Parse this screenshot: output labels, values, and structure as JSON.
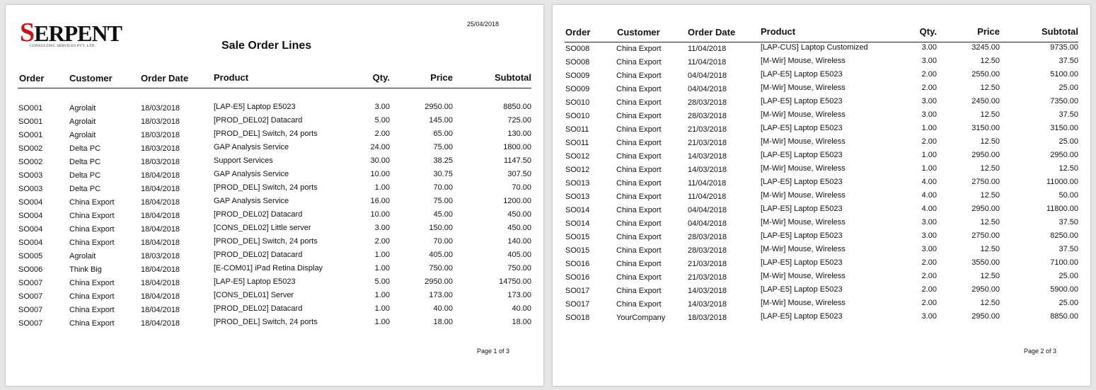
{
  "report": {
    "brand_logo_text": "SERPENT",
    "brand_logo_sub": "CONSULTING SERVICES PVT. LTD.",
    "date": "25/04/2018",
    "title": "Sale Order Lines"
  },
  "columns": {
    "order": "Order",
    "customer": "Customer",
    "order_date": "Order Date",
    "product": "Product",
    "qty": "Qty.",
    "price": "Price",
    "subtotal": "Subtotal"
  },
  "page1": {
    "footer": "Page 1 of 3",
    "rows": [
      [
        "SO001",
        "Agrolait",
        "18/03/2018",
        "[LAP-E5] Laptop E5023",
        "3.00",
        "2950.00",
        "8850.00"
      ],
      [
        "SO001",
        "Agrolait",
        "18/03/2018",
        "[PROD_DEL02] Datacard",
        "5.00",
        "145.00",
        "725.00"
      ],
      [
        "SO001",
        "Agrolait",
        "18/03/2018",
        "[PROD_DEL] Switch, 24 ports",
        "2.00",
        "65.00",
        "130.00"
      ],
      [
        "SO002",
        "Delta PC",
        "18/03/2018",
        "GAP Analysis Service",
        "24.00",
        "75.00",
        "1800.00"
      ],
      [
        "SO002",
        "Delta PC",
        "18/03/2018",
        "Support Services",
        "30.00",
        "38.25",
        "1147.50"
      ],
      [
        "SO003",
        "Delta PC",
        "18/04/2018",
        "GAP Analysis Service",
        "10.00",
        "30.75",
        "307.50"
      ],
      [
        "SO003",
        "Delta PC",
        "18/04/2018",
        "[PROD_DEL] Switch, 24 ports",
        "1.00",
        "70.00",
        "70.00"
      ],
      [
        "SO004",
        "China Export",
        "18/04/2018",
        "GAP Analysis Service",
        "16.00",
        "75.00",
        "1200.00"
      ],
      [
        "SO004",
        "China Export",
        "18/04/2018",
        "[PROD_DEL02] Datacard",
        "10.00",
        "45.00",
        "450.00"
      ],
      [
        "SO004",
        "China Export",
        "18/04/2018",
        "[CONS_DEL02] Little server",
        "3.00",
        "150.00",
        "450.00"
      ],
      [
        "SO004",
        "China Export",
        "18/04/2018",
        "[PROD_DEL] Switch, 24 ports",
        "2.00",
        "70.00",
        "140.00"
      ],
      [
        "SO005",
        "Agrolait",
        "18/03/2018",
        "[PROD_DEL02] Datacard",
        "1.00",
        "405.00",
        "405.00"
      ],
      [
        "SO006",
        "Think Big",
        "18/04/2018",
        "[E-COM01] iPad Retina Display",
        "1.00",
        "750.00",
        "750.00"
      ],
      [
        "SO007",
        "China Export",
        "18/04/2018",
        "[LAP-E5] Laptop E5023",
        "5.00",
        "2950.00",
        "14750.00"
      ],
      [
        "SO007",
        "China Export",
        "18/04/2018",
        "[CONS_DEL01] Server",
        "1.00",
        "173.00",
        "173.00"
      ],
      [
        "SO007",
        "China Export",
        "18/04/2018",
        "[PROD_DEL02] Datacard",
        "1.00",
        "40.00",
        "40.00"
      ],
      [
        "SO007",
        "China Export",
        "18/04/2018",
        "[PROD_DEL] Switch, 24 ports",
        "1.00",
        "18.00",
        "18.00"
      ]
    ]
  },
  "page2": {
    "footer": "Page 2 of 3",
    "rows": [
      [
        "SO008",
        "China Export",
        "11/04/2018",
        "[LAP-CUS] Laptop Customized",
        "3.00",
        "3245.00",
        "9735.00"
      ],
      [
        "SO008",
        "China Export",
        "11/04/2018",
        "[M-Wir] Mouse, Wireless",
        "3.00",
        "12.50",
        "37.50"
      ],
      [
        "SO009",
        "China Export",
        "04/04/2018",
        "[LAP-E5] Laptop E5023",
        "2.00",
        "2550.00",
        "5100.00"
      ],
      [
        "SO009",
        "China Export",
        "04/04/2018",
        "[M-Wir] Mouse, Wireless",
        "2.00",
        "12.50",
        "25.00"
      ],
      [
        "SO010",
        "China Export",
        "28/03/2018",
        "[LAP-E5] Laptop E5023",
        "3.00",
        "2450.00",
        "7350.00"
      ],
      [
        "SO010",
        "China Export",
        "28/03/2018",
        "[M-Wir] Mouse, Wireless",
        "3.00",
        "12.50",
        "37.50"
      ],
      [
        "SO011",
        "China Export",
        "21/03/2018",
        "[LAP-E5] Laptop E5023",
        "1.00",
        "3150.00",
        "3150.00"
      ],
      [
        "SO011",
        "China Export",
        "21/03/2018",
        "[M-Wir] Mouse, Wireless",
        "2.00",
        "12.50",
        "25.00"
      ],
      [
        "SO012",
        "China Export",
        "14/03/2018",
        "[LAP-E5] Laptop E5023",
        "1.00",
        "2950.00",
        "2950.00"
      ],
      [
        "SO012",
        "China Export",
        "14/03/2018",
        "[M-Wir] Mouse, Wireless",
        "1.00",
        "12.50",
        "12.50"
      ],
      [
        "SO013",
        "China Export",
        "11/04/2018",
        "[LAP-E5] Laptop E5023",
        "4.00",
        "2750.00",
        "11000.00"
      ],
      [
        "SO013",
        "China Export",
        "11/04/2018",
        "[M-Wir] Mouse, Wireless",
        "4.00",
        "12.50",
        "50.00"
      ],
      [
        "SO014",
        "China Export",
        "04/04/2018",
        "[LAP-E5] Laptop E5023",
        "4.00",
        "2950.00",
        "11800.00"
      ],
      [
        "SO014",
        "China Export",
        "04/04/2018",
        "[M-Wir] Mouse, Wireless",
        "3.00",
        "12.50",
        "37.50"
      ],
      [
        "SO015",
        "China Export",
        "28/03/2018",
        "[LAP-E5] Laptop E5023",
        "3.00",
        "2750.00",
        "8250.00"
      ],
      [
        "SO015",
        "China Export",
        "28/03/2018",
        "[M-Wir] Mouse, Wireless",
        "3.00",
        "12.50",
        "37.50"
      ],
      [
        "SO016",
        "China Export",
        "21/03/2018",
        "[LAP-E5] Laptop E5023",
        "2.00",
        "3550.00",
        "7100.00"
      ],
      [
        "SO016",
        "China Export",
        "21/03/2018",
        "[M-Wir] Mouse, Wireless",
        "2.00",
        "12.50",
        "25.00"
      ],
      [
        "SO017",
        "China Export",
        "14/03/2018",
        "[LAP-E5] Laptop E5023",
        "2.00",
        "2950.00",
        "5900.00"
      ],
      [
        "SO017",
        "China Export",
        "14/03/2018",
        "[M-Wir] Mouse, Wireless",
        "2.00",
        "12.50",
        "25.00"
      ],
      [
        "SO018",
        "YourCompany",
        "18/03/2018",
        "[LAP-E5] Laptop E5023",
        "3.00",
        "2950.00",
        "8850.00"
      ]
    ]
  }
}
